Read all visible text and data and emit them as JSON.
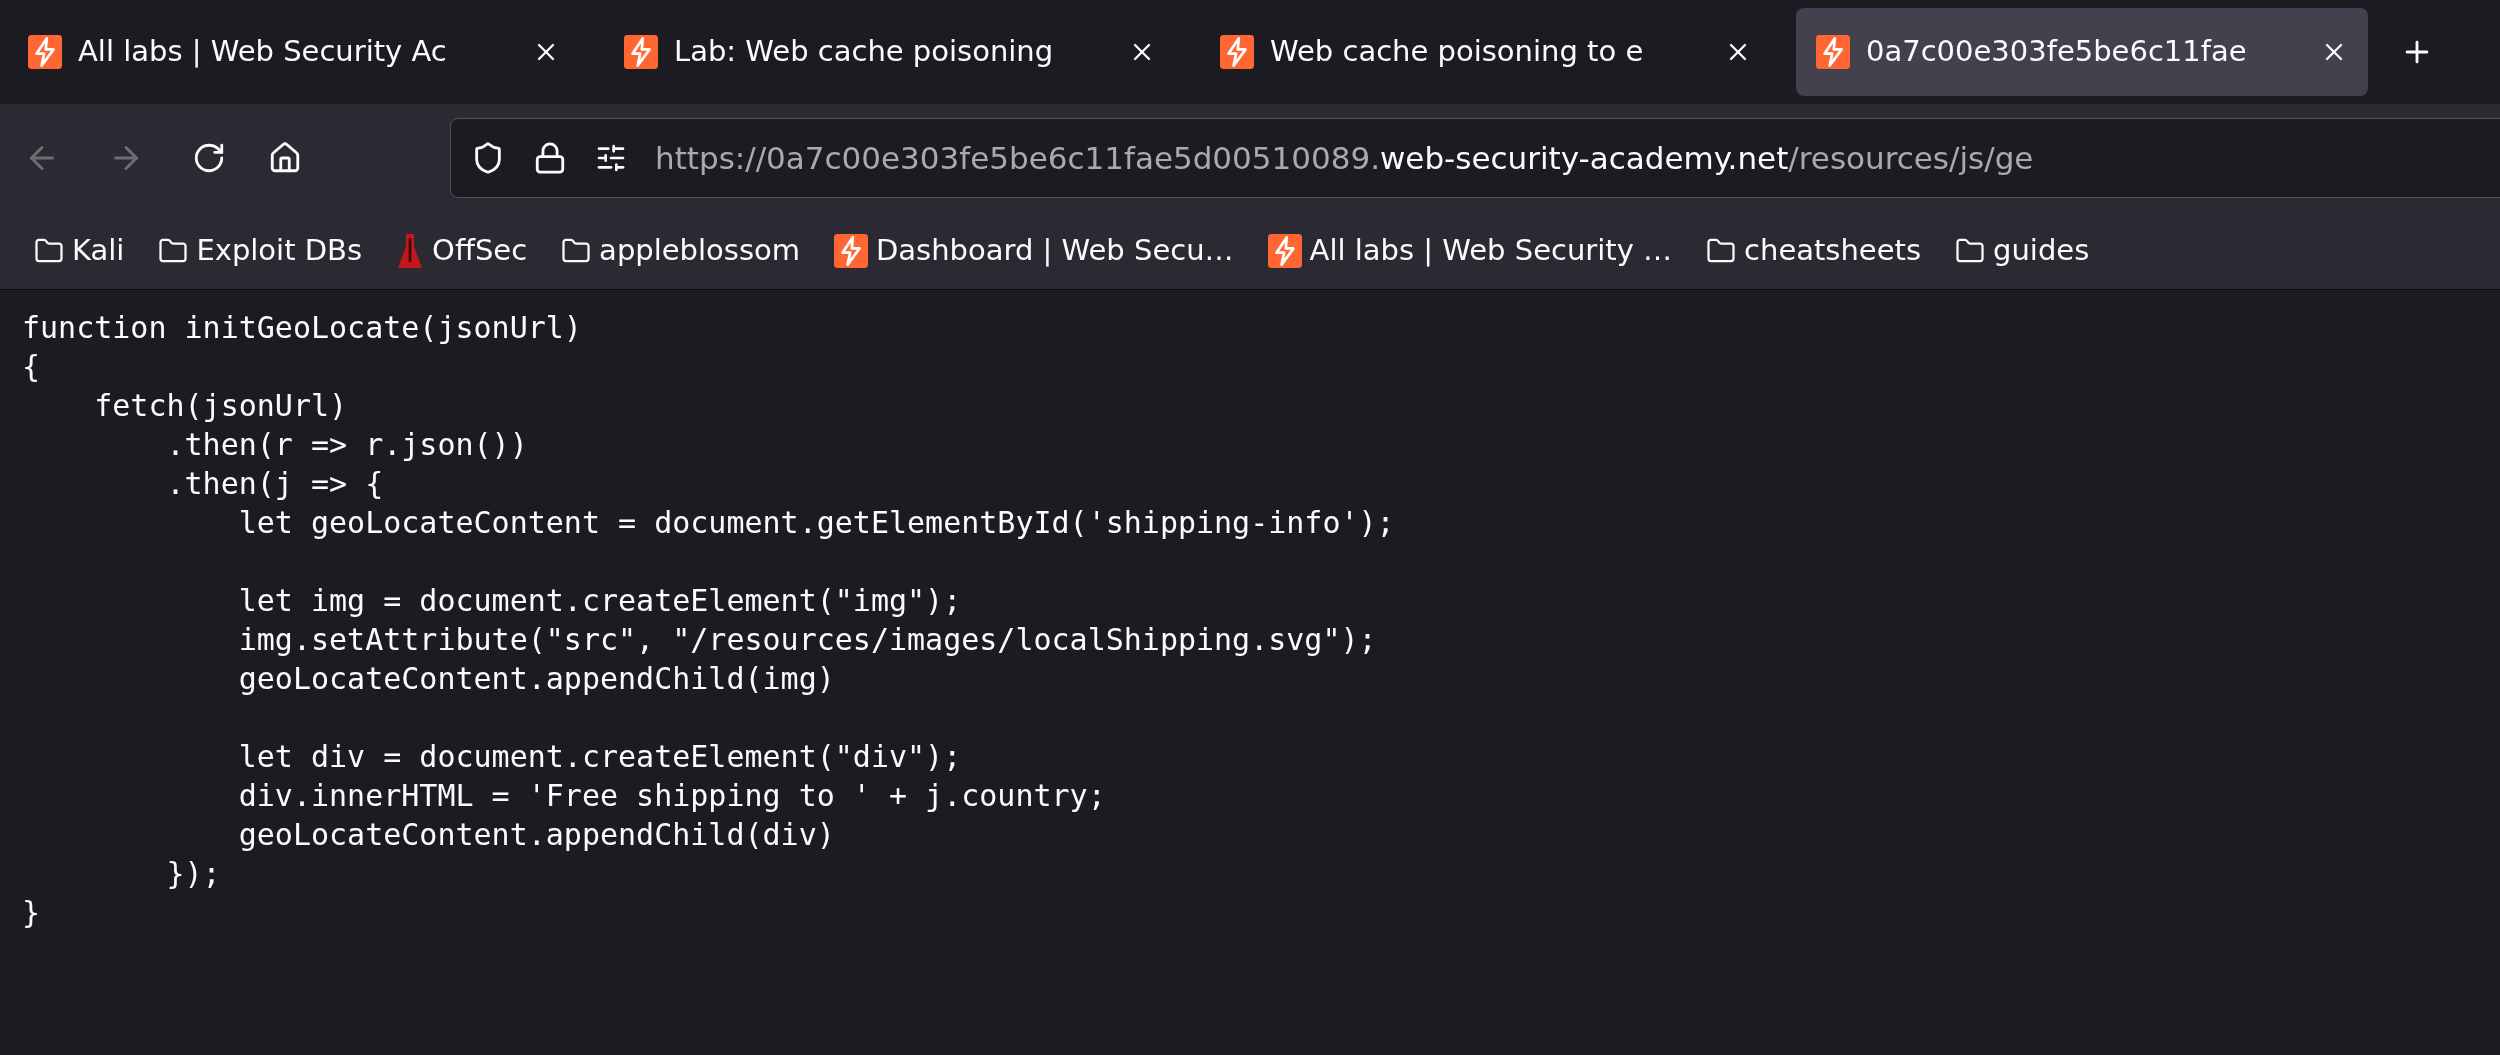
{
  "tabs": [
    {
      "title": "All labs | Web Security Ac",
      "selected": false
    },
    {
      "title": "Lab: Web cache poisoning",
      "selected": false
    },
    {
      "title": "Web cache poisoning to e",
      "selected": false
    },
    {
      "title": "0a7c00e303fe5be6c11fae",
      "selected": true
    }
  ],
  "toolbar": {
    "back_disabled": true,
    "forward_disabled": true,
    "url": {
      "prefix": "https://0a7c00e303fe5be6c11fae5d00510089.",
      "domain": "web-security-academy.net",
      "path": "/resources/js/ge"
    }
  },
  "bookmarks": [
    {
      "kind": "folder",
      "label": "Kali"
    },
    {
      "kind": "folder",
      "label": "Exploit DBs"
    },
    {
      "kind": "flask",
      "label": "OffSec"
    },
    {
      "kind": "folder",
      "label": "appleblossom"
    },
    {
      "kind": "lab",
      "label": "Dashboard | Web Secu…"
    },
    {
      "kind": "lab",
      "label": "All labs | Web Security …"
    },
    {
      "kind": "folder",
      "label": "cheatsheets"
    },
    {
      "kind": "folder",
      "label": "guides"
    }
  ],
  "content": {
    "code": "function initGeoLocate(jsonUrl)\n{\n    fetch(jsonUrl)\n        .then(r => r.json())\n        .then(j => {\n            let geoLocateContent = document.getElementById('shipping-info');\n\n            let img = document.createElement(\"img\");\n            img.setAttribute(\"src\", \"/resources/images/localShipping.svg\");\n            geoLocateContent.appendChild(img)\n\n            let div = document.createElement(\"div\");\n            div.innerHTML = 'Free shipping to ' + j.country;\n            geoLocateContent.appendChild(div)\n        });\n}"
  }
}
